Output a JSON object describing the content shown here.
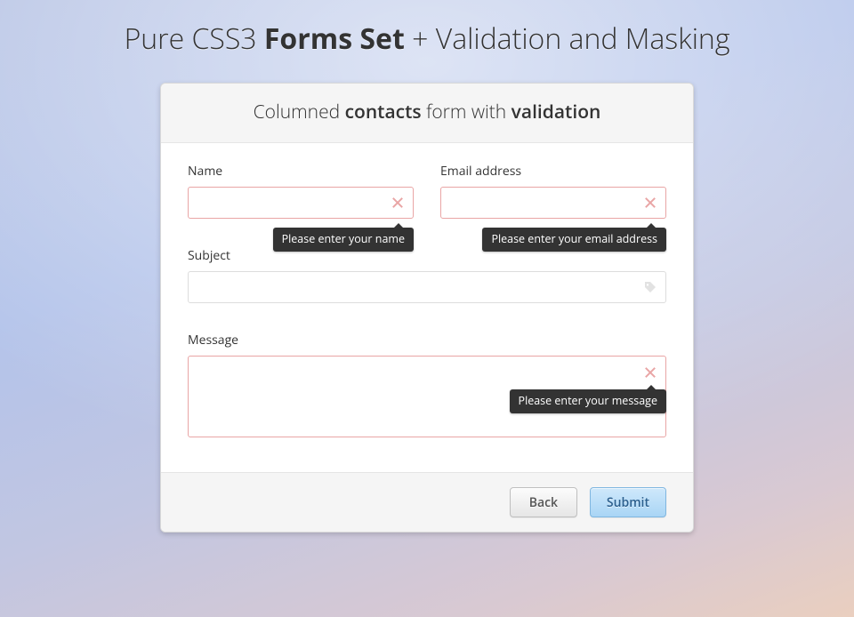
{
  "page": {
    "title_parts": [
      "Pure CSS3 ",
      "Forms Set",
      " + Validation and Masking"
    ]
  },
  "form": {
    "header_parts": [
      "Columned ",
      "contacts",
      " form with ",
      "validation"
    ],
    "name": {
      "label": "Name",
      "value": "",
      "error": "Please enter your name"
    },
    "email": {
      "label": "Email address",
      "value": "",
      "error": "Please enter your email address"
    },
    "subject": {
      "label": "Subject",
      "value": ""
    },
    "message": {
      "label": "Message",
      "value": "",
      "error": "Please enter your message"
    },
    "buttons": {
      "back": "Back",
      "submit": "Submit"
    }
  }
}
